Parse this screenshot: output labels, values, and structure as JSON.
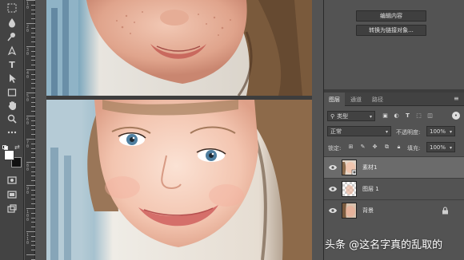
{
  "tools": {
    "icons": [
      "select-icon",
      "lasso-icon",
      "brush-icon",
      "clone-stamp-icon",
      "eraser-icon",
      "gradient-icon",
      "blur-icon",
      "dodge-icon",
      "pen-icon",
      "type-icon",
      "path-select-icon",
      "rectangle-icon",
      "hand-icon",
      "zoom-icon",
      "more-icon",
      "quick-mask-icon",
      "screen-mode-icon"
    ],
    "type_glyph": "T"
  },
  "ruler": {
    "numbers": [
      "1\n0",
      "2\n0",
      "3\n0",
      "4\n0",
      "5\n0",
      "6\n0",
      "7\n0",
      "8\n0",
      "9\n0",
      "1\n0\n0",
      "1\n1\n0"
    ]
  },
  "properties": {
    "edit_contents": "编辑内容",
    "convert_to_linked": "转换为链接对象..."
  },
  "layers_panel": {
    "tabs": [
      "图层",
      "通道",
      "路径"
    ],
    "active_tab": 0,
    "filter_label": "类型",
    "blend_mode": "正常",
    "opacity_label": "不透明度:",
    "opacity_value": "100%",
    "lock_label": "锁定:",
    "fill_label": "填充:",
    "fill_value": "100%",
    "layers": [
      {
        "name": "素材1",
        "visible": true,
        "selected": true,
        "kind": "smart-object"
      },
      {
        "name": "图层 1",
        "visible": true,
        "selected": false,
        "kind": "transparent"
      },
      {
        "name": "背景",
        "visible": true,
        "selected": false,
        "kind": "background",
        "locked": true
      }
    ]
  },
  "watermark": "头条 @这名字真的乱取的",
  "colors": {
    "panel_bg": "#535353",
    "toolbar_bg": "#434343",
    "selected_layer": "#6b6b6b"
  }
}
